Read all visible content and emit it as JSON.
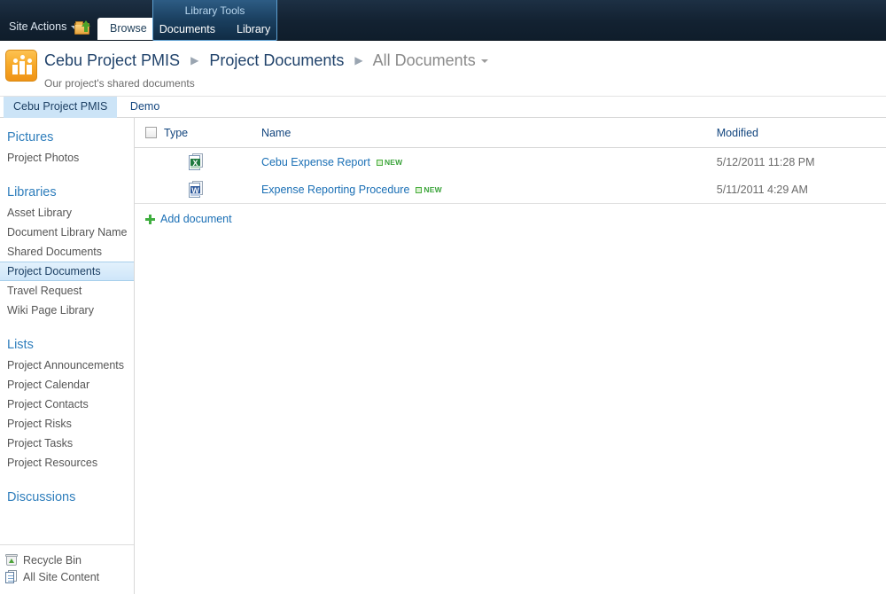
{
  "topbar": {
    "site_actions_label": "Site Actions",
    "nav_up_icon": "navigate-up-folder-icon",
    "browse_tab": "Browse",
    "contextual_group_title": "Library Tools",
    "contextual_tabs": [
      {
        "label": "Documents"
      },
      {
        "label": "Library"
      }
    ]
  },
  "site_header": {
    "logo_icon": "site-group-icon",
    "breadcrumb": [
      {
        "label": "Cebu Project PMIS"
      },
      {
        "label": "Project Documents"
      }
    ],
    "view_name": "All Documents",
    "description": "Our project's shared documents"
  },
  "toplinks": {
    "items": [
      {
        "label": "Cebu Project PMIS",
        "selected": true
      },
      {
        "label": "Demo",
        "selected": false
      }
    ]
  },
  "sidebar": {
    "groups": [
      {
        "heading": "Pictures",
        "items": [
          {
            "label": "Project Photos",
            "selected": false
          }
        ]
      },
      {
        "heading": "Libraries",
        "items": [
          {
            "label": "Asset Library",
            "selected": false
          },
          {
            "label": "Document Library Name",
            "selected": false
          },
          {
            "label": "Shared Documents",
            "selected": false
          },
          {
            "label": "Project Documents",
            "selected": true
          },
          {
            "label": "Travel Request",
            "selected": false
          },
          {
            "label": "Wiki Page Library",
            "selected": false
          }
        ]
      },
      {
        "heading": "Lists",
        "items": [
          {
            "label": "Project Announcements",
            "selected": false
          },
          {
            "label": "Project Calendar",
            "selected": false
          },
          {
            "label": "Project Contacts",
            "selected": false
          },
          {
            "label": "Project Risks",
            "selected": false
          },
          {
            "label": "Project Tasks",
            "selected": false
          },
          {
            "label": "Project Resources",
            "selected": false
          }
        ]
      },
      {
        "heading": "Discussions",
        "items": []
      }
    ],
    "footer": [
      {
        "label": "Recycle Bin",
        "icon": "recycle-bin-icon"
      },
      {
        "label": "All Site Content",
        "icon": "all-site-content-icon"
      }
    ]
  },
  "document_list": {
    "columns": [
      {
        "label": "Type"
      },
      {
        "label": "Name"
      },
      {
        "label": "Modified"
      }
    ],
    "rows": [
      {
        "file_type": "excel",
        "file_type_glyph": "X",
        "name": "Cebu Expense Report",
        "badge": "NEW",
        "modified": "5/12/2011 11:28 PM"
      },
      {
        "file_type": "word",
        "file_type_glyph": "W",
        "name": "Expense Reporting Procedure",
        "badge": "NEW",
        "modified": "5/11/2011 4:29 AM"
      }
    ],
    "add_document_label": "Add document"
  },
  "colors": {
    "ribbon_dark": "#132232",
    "link_blue": "#1a6fb5",
    "heading_blue": "#2f7ebc",
    "selected_nav": "#d9ecfb",
    "accent_orange": "#f7a928",
    "new_badge_green": "#3aa33a"
  }
}
